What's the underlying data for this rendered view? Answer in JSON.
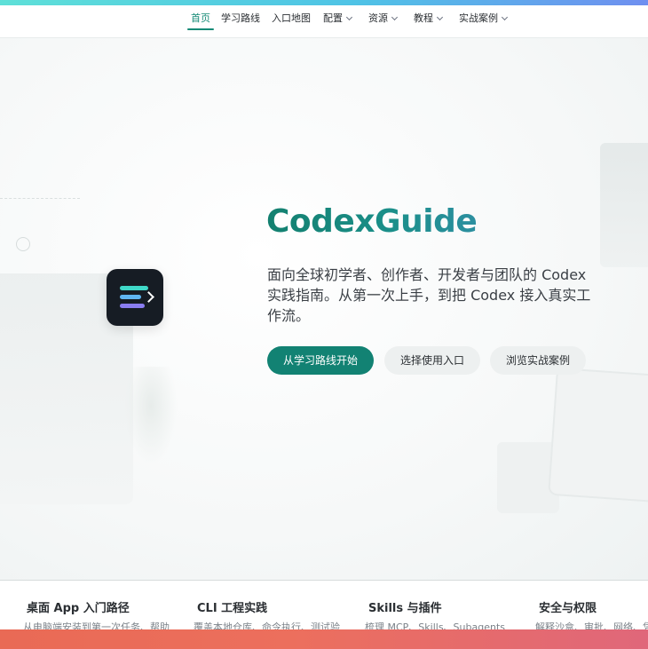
{
  "nav": {
    "items": [
      {
        "label": "首页",
        "active": true,
        "dropdown": false
      },
      {
        "label": "学习路线",
        "active": false,
        "dropdown": false
      },
      {
        "label": "入口地图",
        "active": false,
        "dropdown": false
      },
      {
        "label": "配置",
        "active": false,
        "dropdown": true
      },
      {
        "label": "资源",
        "active": false,
        "dropdown": true
      },
      {
        "label": "教程",
        "active": false,
        "dropdown": true
      },
      {
        "label": "实战案例",
        "active": false,
        "dropdown": true
      }
    ]
  },
  "hero": {
    "title": "CodexGuide",
    "description": "面向全球初学者、创作者、开发者与团队的 Codex 实践指南。从第一次上手，到把 Codex 接入真实工作流。",
    "primary_button": "从学习路线开始",
    "secondary_button": "选择使用入口",
    "tertiary_button": "浏览实战案例"
  },
  "features": [
    {
      "title": "桌面 App 入门路径",
      "desc": "从电脑端安装到第一次任务、帮助"
    },
    {
      "title": "CLI 工程实践",
      "desc": "覆盖本地仓库、命令执行、测试验"
    },
    {
      "title": "Skills 与插件",
      "desc": "梳理 MCP、Skills、Subagents"
    },
    {
      "title": "安全与权限",
      "desc": "解释沙盒、审批、网络、凭"
    }
  ],
  "colors": {
    "brand": "#128273",
    "top_accent": "#5ee0d8",
    "bottom_accent": "#e96a55",
    "logo_bg": "#161c24"
  }
}
